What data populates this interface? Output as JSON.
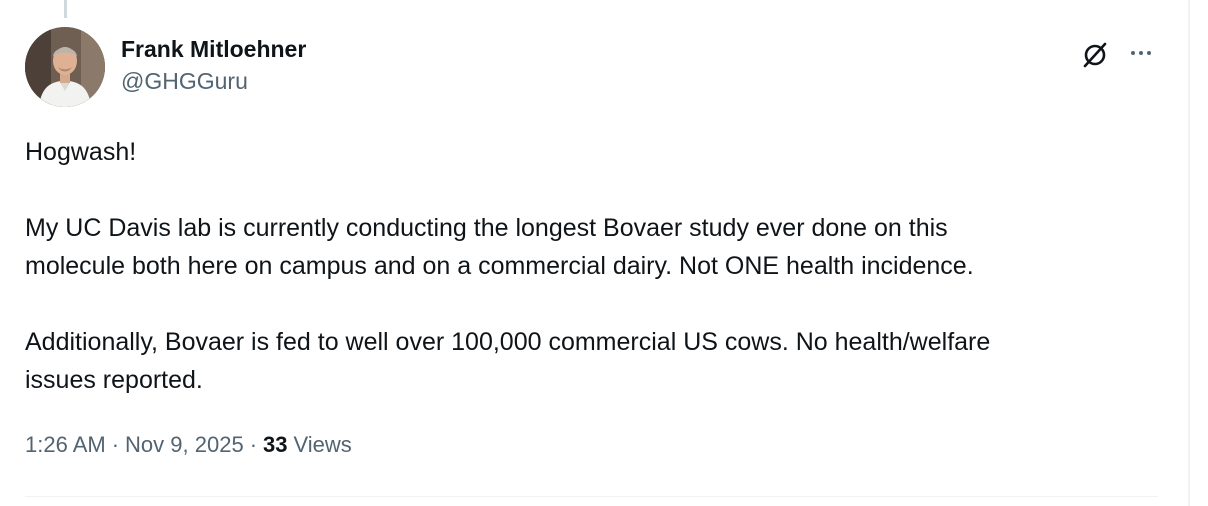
{
  "author": {
    "display_name": "Frank Mitloehner",
    "handle": "@GHGGuru",
    "avatar_icon": "person-photo"
  },
  "actions": {
    "grok_icon": "grok-icon",
    "more_icon": "more-horizontal-icon"
  },
  "tweet": {
    "paragraphs": [
      [
        "Hogwash!"
      ],
      [
        "My UC Davis lab is currently conducting the longest Bovaer study ever done on this",
        "molecule both here on campus and on a commercial dairy. Not ONE health incidence."
      ],
      [
        "Additionally, Bovaer is fed to well over 100,000 commercial US cows. No health/welfare",
        "issues reported."
      ]
    ]
  },
  "meta": {
    "time": "1:26 AM",
    "separator": "·",
    "date": "Nov 9, 2025",
    "views_count": "33",
    "views_label": "Views"
  },
  "colors": {
    "text_primary": "#0f1419",
    "text_secondary": "#536471",
    "divider": "#eff3f4",
    "thread_line": "#cfd9de"
  }
}
